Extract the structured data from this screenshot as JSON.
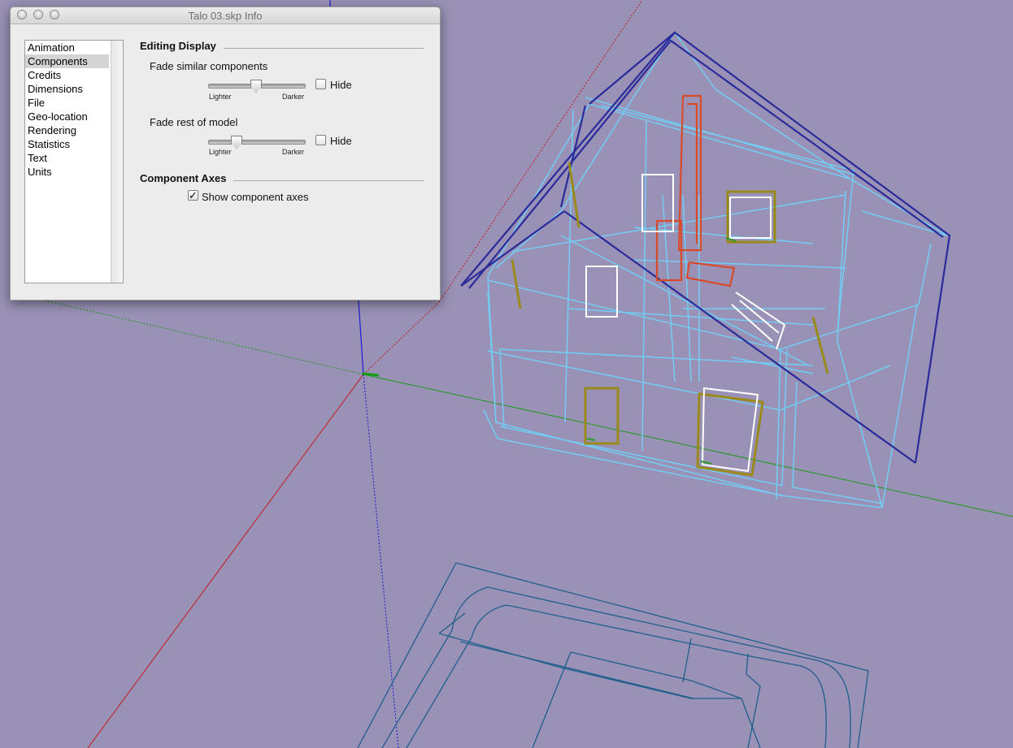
{
  "window": {
    "title": "Talo 03.skp Info"
  },
  "sidebar": {
    "items": [
      {
        "label": "Animation"
      },
      {
        "label": "Components",
        "selected": true
      },
      {
        "label": "Credits"
      },
      {
        "label": "Dimensions"
      },
      {
        "label": "File"
      },
      {
        "label": "Geo-location"
      },
      {
        "label": "Rendering"
      },
      {
        "label": "Statistics"
      },
      {
        "label": "Text"
      },
      {
        "label": "Units"
      }
    ]
  },
  "editing_display": {
    "heading": "Editing Display",
    "fade_similar": {
      "label": "Fade similar components",
      "left_label": "Lighter",
      "right_label": "Darker",
      "level": 0.5,
      "hide_label": "Hide",
      "hide_checked": false,
      "hide_mark": ""
    },
    "fade_rest": {
      "label": "Fade rest of model",
      "left_label": "Lighter",
      "right_label": "Darker",
      "level": 0.27,
      "hide_label": "Hide",
      "hide_checked": false,
      "hide_mark": ""
    }
  },
  "component_axes": {
    "heading": "Component Axes",
    "show_label": "Show component axes",
    "show_checked": true,
    "check_mark": "✓"
  },
  "colors": {
    "background": "#9a91b6",
    "axis_red": "#c21a1a",
    "axis_green": "#1a9a1a",
    "axis_blue": "#1a1ad2",
    "wire": "#72cdf4",
    "roof": "#2a2a9a",
    "chimney": "#d84b2a",
    "frame": "#9a8a1c",
    "terrain": "#1f5f8c"
  }
}
